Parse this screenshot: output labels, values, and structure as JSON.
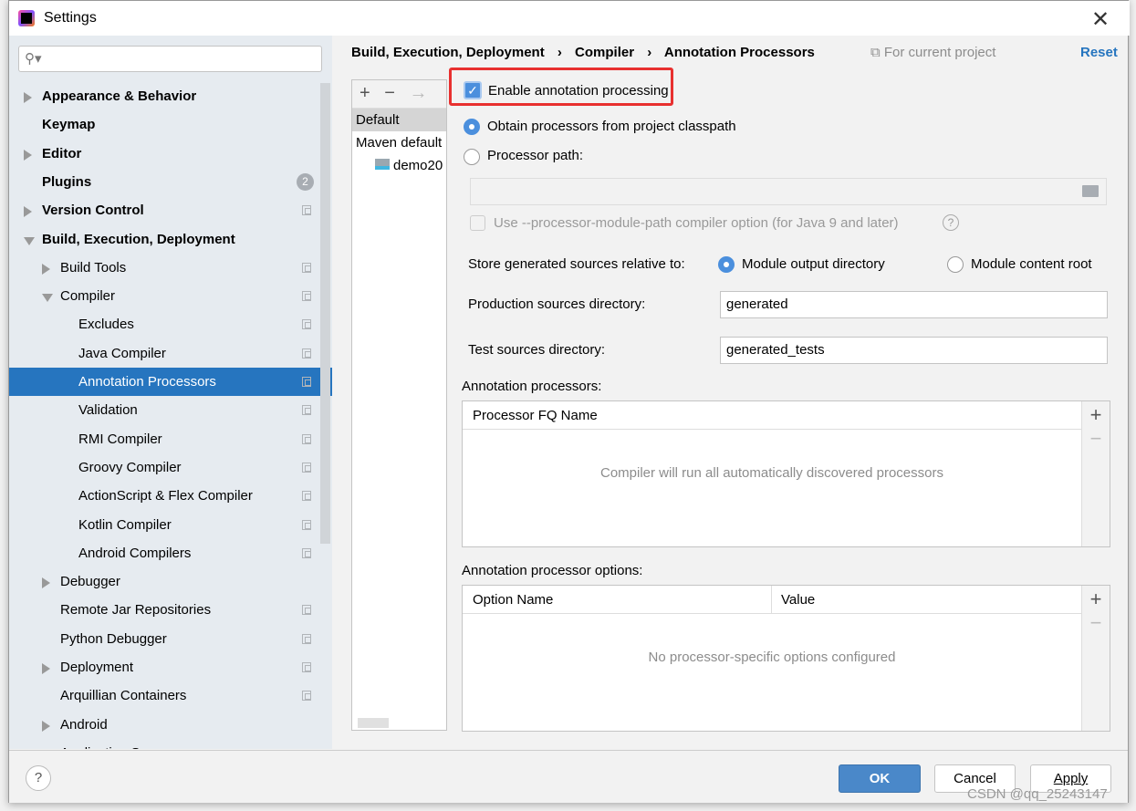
{
  "window": {
    "title": "Settings"
  },
  "search": {
    "placeholder": ""
  },
  "sidebar": {
    "items": [
      {
        "label": "Appearance & Behavior",
        "bold": true,
        "arrow": "r",
        "indent": 0
      },
      {
        "label": "Keymap",
        "bold": true,
        "arrow": "",
        "indent": 0
      },
      {
        "label": "Editor",
        "bold": true,
        "arrow": "r",
        "indent": 0
      },
      {
        "label": "Plugins",
        "bold": true,
        "arrow": "",
        "indent": 0,
        "badge": "2"
      },
      {
        "label": "Version Control",
        "bold": true,
        "arrow": "r",
        "indent": 0,
        "copy": true
      },
      {
        "label": "Build, Execution, Deployment",
        "bold": true,
        "arrow": "d",
        "indent": 0
      },
      {
        "label": "Build Tools",
        "arrow": "r",
        "indent": 1,
        "copy": true
      },
      {
        "label": "Compiler",
        "arrow": "d",
        "indent": 1,
        "copy": true
      },
      {
        "label": "Excludes",
        "indent": 2,
        "copy": true
      },
      {
        "label": "Java Compiler",
        "indent": 2,
        "copy": true
      },
      {
        "label": "Annotation Processors",
        "indent": 2,
        "copy": true,
        "selected": true
      },
      {
        "label": "Validation",
        "indent": 2,
        "copy": true
      },
      {
        "label": "RMI Compiler",
        "indent": 2,
        "copy": true
      },
      {
        "label": "Groovy Compiler",
        "indent": 2,
        "copy": true
      },
      {
        "label": "ActionScript & Flex Compiler",
        "indent": 2,
        "copy": true
      },
      {
        "label": "Kotlin Compiler",
        "indent": 2,
        "copy": true
      },
      {
        "label": "Android Compilers",
        "indent": 2,
        "copy": true
      },
      {
        "label": "Debugger",
        "arrow": "r",
        "indent": 1
      },
      {
        "label": "Remote Jar Repositories",
        "indent": 1,
        "copy": true
      },
      {
        "label": "Python Debugger",
        "indent": 1,
        "copy": true
      },
      {
        "label": "Deployment",
        "arrow": "r",
        "indent": 1,
        "copy": true
      },
      {
        "label": "Arquillian Containers",
        "indent": 1,
        "copy": true
      },
      {
        "label": "Android",
        "arrow": "r",
        "indent": 1
      },
      {
        "label": "Application S",
        "indent": 1
      }
    ]
  },
  "breadcrumb": {
    "items": [
      "Build, Execution, Deployment",
      "Compiler",
      "Annotation Processors"
    ],
    "scope": "For current project",
    "reset": "Reset"
  },
  "profiles": {
    "items": [
      "Default",
      "Maven default",
      "demo20"
    ]
  },
  "form": {
    "enable_label": "Enable annotation processing",
    "enable_checked": true,
    "obtain_label": "Obtain processors from project classpath",
    "path_label": "Processor path:",
    "path_value": "",
    "module_path_label": "Use --processor-module-path compiler option (for Java 9 and later)",
    "store_label": "Store generated sources relative to:",
    "store_opt1": "Module output directory",
    "store_opt2": "Module content root",
    "prod_label": "Production sources directory:",
    "prod_value": "generated",
    "test_label": "Test sources directory:",
    "test_value": "generated_tests",
    "processors_label": "Annotation processors:",
    "processors_col": "Processor FQ Name",
    "processors_empty": "Compiler will run all automatically discovered processors",
    "options_label": "Annotation processor options:",
    "options_col1": "Option Name",
    "options_col2": "Value",
    "options_empty": "No processor-specific options configured"
  },
  "footer": {
    "ok": "OK",
    "cancel": "Cancel",
    "apply": "Apply",
    "help": "?"
  },
  "watermark": "CSDN @qq_25243147",
  "colors": {
    "accent": "#2675bf",
    "highlight_box": "#e8302f",
    "ok": "#4a88c9"
  }
}
